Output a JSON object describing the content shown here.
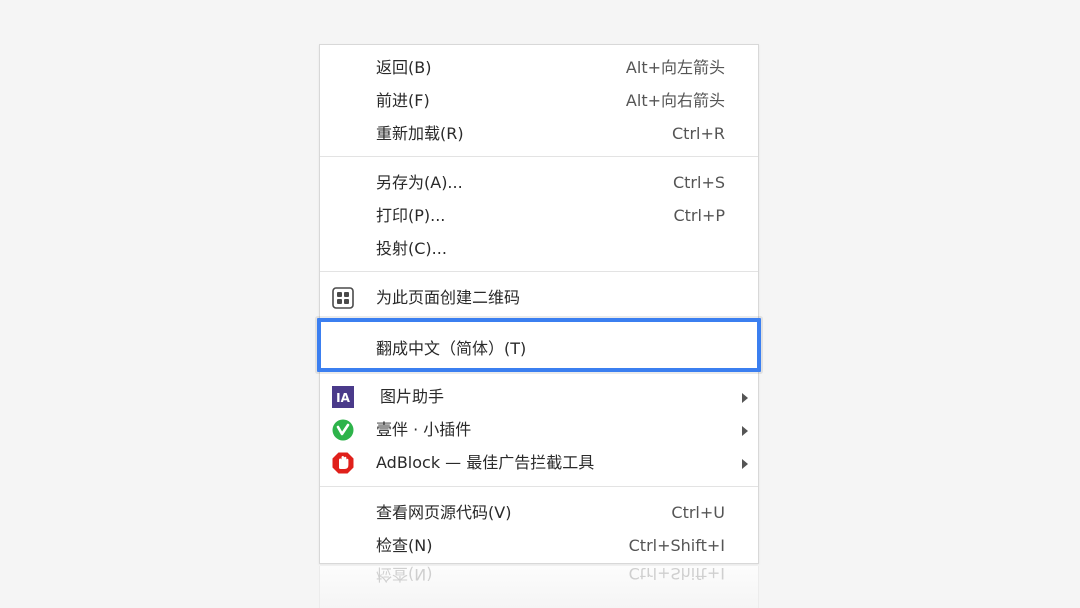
{
  "menu": {
    "back": {
      "label": "返回(B)",
      "shortcut": "Alt+向左箭头"
    },
    "forward": {
      "label": "前进(F)",
      "shortcut": "Alt+向右箭头"
    },
    "reload": {
      "label": "重新加载(R)",
      "shortcut": "Ctrl+R"
    },
    "save_as": {
      "label": "另存为(A)...",
      "shortcut": "Ctrl+S"
    },
    "print": {
      "label": "打印(P)...",
      "shortcut": "Ctrl+P"
    },
    "cast": {
      "label": "投射(C)..."
    },
    "qr_code": {
      "label": "为此页面创建二维码",
      "icon": "qr-code-icon"
    },
    "translate": {
      "label": "翻成中文（简体）(T)"
    },
    "image_helper": {
      "label": "图片助手",
      "icon_text": "IA",
      "icon_color": "#4a3a8a"
    },
    "yiban": {
      "label": "壹伴 · 小插件",
      "icon_color": "#2db34a"
    },
    "adblock": {
      "label": "AdBlock — 最佳广告拦截工具",
      "icon_color": "#e0201b"
    },
    "view_source": {
      "label": "查看网页源代码(V)",
      "shortcut": "Ctrl+U"
    },
    "inspect": {
      "label": "检查(N)",
      "shortcut": "Ctrl+Shift+I"
    }
  },
  "colors": {
    "highlight_border": "#3b7ff0",
    "background": "#f5f5f5"
  }
}
